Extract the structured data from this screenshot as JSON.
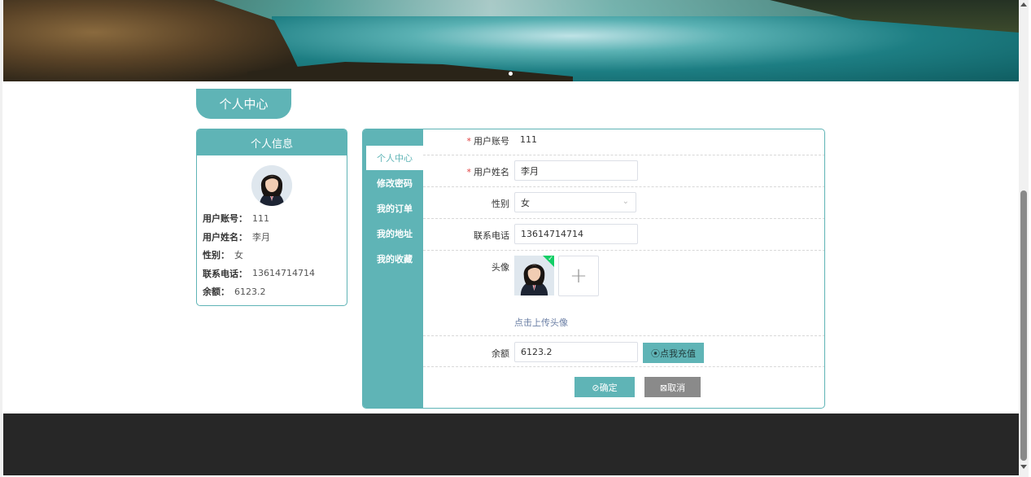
{
  "banner": {
    "image_name": "lake-waterfall-banner"
  },
  "section_title": "个人中心",
  "info_card": {
    "title": "个人信息",
    "rows": [
      {
        "label": "用户账号：",
        "value": "111"
      },
      {
        "label": "用户姓名：",
        "value": "李月"
      },
      {
        "label": "性别：",
        "value": "女"
      },
      {
        "label": "联系电话：",
        "value": "13614714714"
      },
      {
        "label": "余额：",
        "value": "6123.2"
      }
    ]
  },
  "side_nav": {
    "items": [
      {
        "label": "个人中心",
        "active": true
      },
      {
        "label": "修改密码",
        "active": false
      },
      {
        "label": "我的订单",
        "active": false
      },
      {
        "label": "我的地址",
        "active": false
      },
      {
        "label": "我的收藏",
        "active": false
      }
    ]
  },
  "form": {
    "account_label": "用户账号",
    "account_value": "111",
    "name_label": "用户姓名",
    "name_value": "李月",
    "gender_label": "性别",
    "gender_value": "女",
    "phone_label": "联系电话",
    "phone_value": "13614714714",
    "avatar_label": "头像",
    "upload_tip": "点击上传头像",
    "balance_label": "余额",
    "balance_value": "6123.2",
    "recharge_button": "⦿点我充值",
    "ok_button": "⊘确定",
    "cancel_button": "⊠取消",
    "required_mark": "*"
  },
  "colors": {
    "accent": "#5fb4b6",
    "footer": "#272727",
    "cancel": "#8a8a8a",
    "required": "#e04040",
    "success": "#13ce66"
  }
}
